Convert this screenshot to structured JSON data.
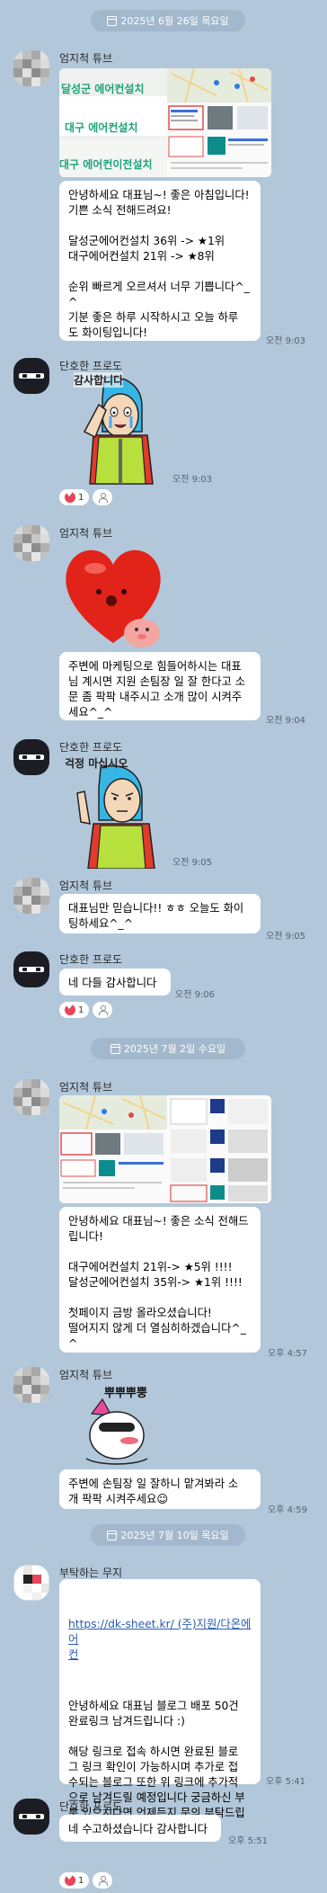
{
  "dates": [
    "2025년 6월 26일 목요일",
    "2025년 7월 2일 수요일",
    "2025년 7월 10일 목요일"
  ],
  "users": {
    "a": "엄지척 튜브",
    "b": "단호한 프로도",
    "c": "부탁하는 무지"
  },
  "messages": [
    {
      "time": "오전 9:03",
      "text": "안녕하세요 대표님~! 좋은 아침입니다!\n기쁜 소식 전해드려요!\n\n달성군에어컨설치 36위 -> ★1위\n대구에어컨설치 21위 -> ★8위\n\n순위 빠르게 오르셔서 너무 기쁩니다^_\n^\n기분 좋은 하루 시작하시고 오늘 하루\n도 화이팅입니다!"
    },
    {
      "time": "오전 9:03",
      "caption": "감사합니다"
    },
    {
      "time": "오전 9:04",
      "text": "주변에 마케팅으로 힘들어하시는 대표\n님 계시면 지원 손팀장 일 잘 한다고 소\n문 좀 팍팍 내주시고 소개 많이 시켜주\n세요^_^"
    },
    {
      "time": "오전 9:05",
      "caption": "걱정 마십시오"
    },
    {
      "time": "오전 9:05",
      "text": "대표님만 믿습니다!! ㅎㅎ 오늘도 화이\n팅하세요^_^"
    },
    {
      "time": "오전 9:06",
      "text": "네 다들 감사합니다"
    },
    {
      "time": "오후 4:57",
      "text": "안녕하세요 대표님~! 좋은 소식 전해드\n립니다!\n\n대구에어컨설치 21위-> ★5위 !!!!\n달성군에어컨설치 35위-> ★1위 !!!!\n\n첫페이지 금방 올라오셨습니다!\n떨어지지 않게 더 열심히하겠습니다^_\n^"
    },
    {
      "time": "오후 4:59",
      "text": "주변에 손팀장 일 잘하니 맡겨봐라 소\n개 팍팍 시켜주세요☺"
    },
    {
      "time": "오후 5:41",
      "link": "https://dk-sheet.kr/ (주)지원/다온에어\n컨",
      "text": "안녕하세요 대표님 블로그 배포 50건\n완료링크 남겨드립니다 :)\n\n해당 링크로 접속 하시면 완료된 블로\n그 링크 확인이 가능하시며 추가로 접\n수되는 블로그 또한 위 링크에 추가적\n으로 남겨드릴 예정입니다 궁금하신 부\n분 있으시다면 언제든지 문의 부탁드립\n니다 !!"
    },
    {
      "time": "오후 5:51",
      "text": "네 수고하셨습니다 감사합니다"
    }
  ],
  "reactions": {
    "count": "1"
  },
  "shot1": {
    "rows": [
      "달성군 에어컨설치",
      "대구 에어컨설치",
      "대구 에어컨이전설치"
    ]
  },
  "sticker_text": "뿌뿌뿌뿡",
  "colors": {
    "bg": "#b2c7da",
    "pill": "#a3b8cc",
    "heart": "#e8455a",
    "link": "#2a5db0"
  }
}
